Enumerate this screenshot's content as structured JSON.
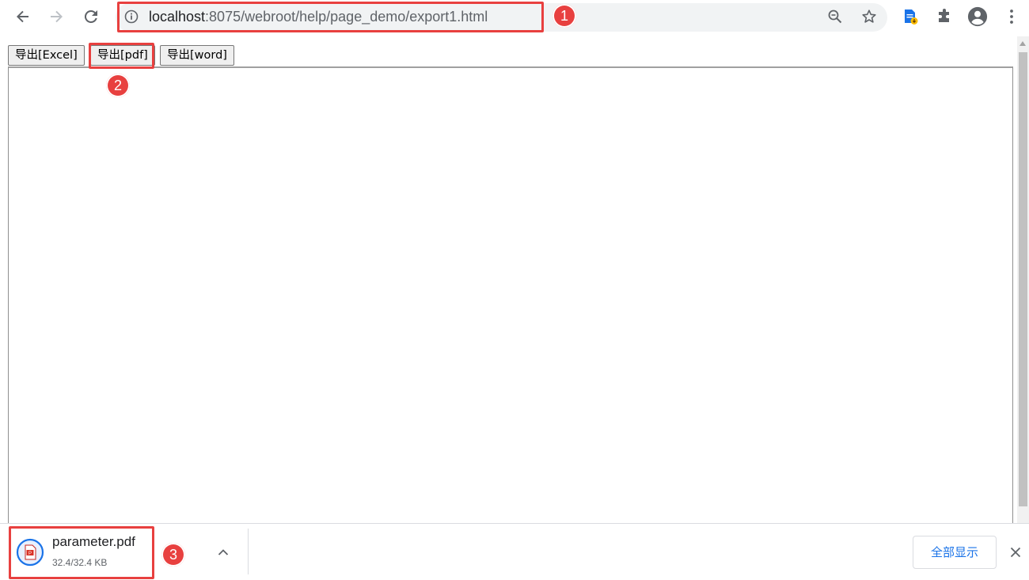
{
  "browser": {
    "url_host": "localhost",
    "url_path": ":8075/webroot/help/page_demo/export1.html",
    "icons": {
      "back": "arrow-left-icon",
      "forward": "arrow-right-icon",
      "reload": "reload-icon",
      "info": "info-icon",
      "zoom": "zoom-icon",
      "bookmark": "star-icon",
      "extension": "document-extension-icon",
      "extensions": "puzzle-icon",
      "profile": "account-icon",
      "menu": "more-vertical-icon"
    }
  },
  "page": {
    "buttons": [
      {
        "label": "导出[Excel]"
      },
      {
        "label": "导出[pdf]"
      },
      {
        "label": "导出[word]"
      }
    ]
  },
  "download": {
    "file_name": "parameter.pdf",
    "progress": "32.4/32.4 KB",
    "show_all_label": "全部显示"
  },
  "annotations": [
    "1",
    "2",
    "3"
  ],
  "colors": {
    "annotation": "#e8403f",
    "link_blue": "#1a73e8",
    "omnibox_bg": "#f1f3f4"
  }
}
